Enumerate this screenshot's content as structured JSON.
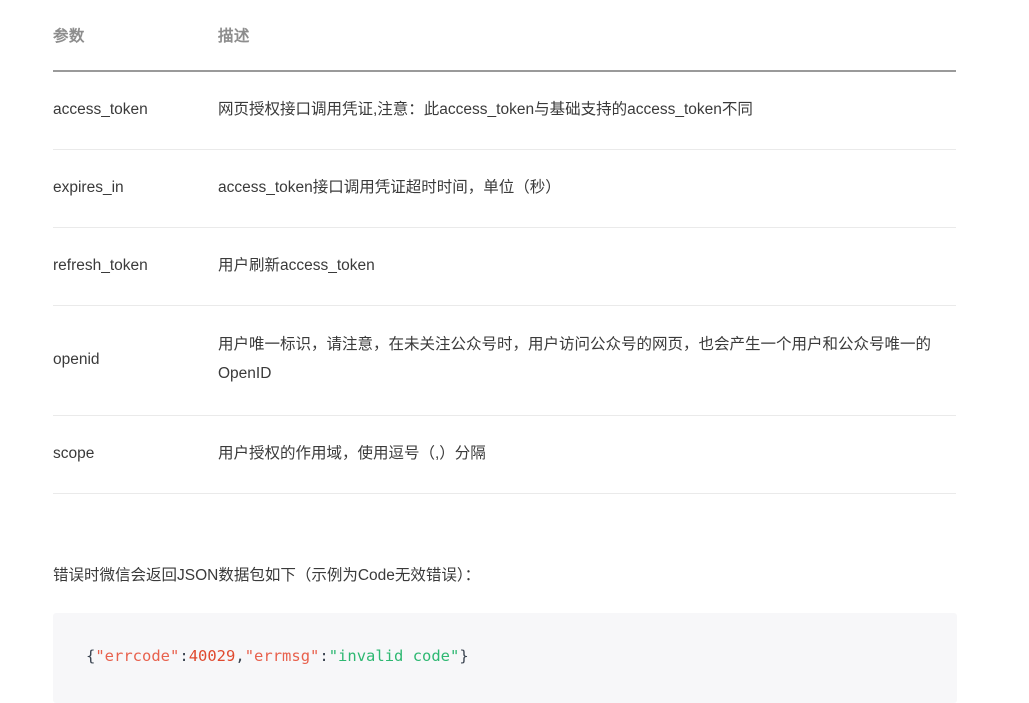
{
  "table": {
    "headers": {
      "param": "参数",
      "description": "描述"
    },
    "rows": [
      {
        "name": "access_token",
        "description": "网页授权接口调用凭证,注意：此access_token与基础支持的access_token不同"
      },
      {
        "name": "expires_in",
        "description": "access_token接口调用凭证超时时间，单位（秒）"
      },
      {
        "name": "refresh_token",
        "description": "用户刷新access_token"
      },
      {
        "name": "openid",
        "description": "用户唯一标识，请注意，在未关注公众号时，用户访问公众号的网页，也会产生一个用户和公众号唯一的OpenID"
      },
      {
        "name": "scope",
        "description": "用户授权的作用域，使用逗号（,）分隔"
      }
    ]
  },
  "note": {
    "text": "错误时微信会返回JSON数据包如下（示例为Code无效错误）："
  },
  "code_block": {
    "language": "json",
    "tokens": [
      {
        "text": "{",
        "type": "punct"
      },
      {
        "text": "\"errcode\"",
        "type": "key"
      },
      {
        "text": ":",
        "type": "punct"
      },
      {
        "text": "40029",
        "type": "number"
      },
      {
        "text": ",",
        "type": "punct"
      },
      {
        "text": "\"errmsg\"",
        "type": "key"
      },
      {
        "text": ":",
        "type": "punct"
      },
      {
        "text": "\"invalid code\"",
        "type": "string"
      },
      {
        "text": "}",
        "type": "punct"
      }
    ],
    "plain_text": "{\"errcode\":40029,\"errmsg\":\"invalid code\"}"
  },
  "colors": {
    "background": "#ffffff",
    "header_text": "#8d8d8d",
    "header_border": "#9a9a9a",
    "row_border": "#eaeaea",
    "body_text": "#3a3a3a",
    "code_background": "#f7f7f9",
    "token_punct": "#3b4451",
    "token_key": "#e8614d",
    "token_number": "#e04a2f",
    "token_string": "#2eb872"
  }
}
